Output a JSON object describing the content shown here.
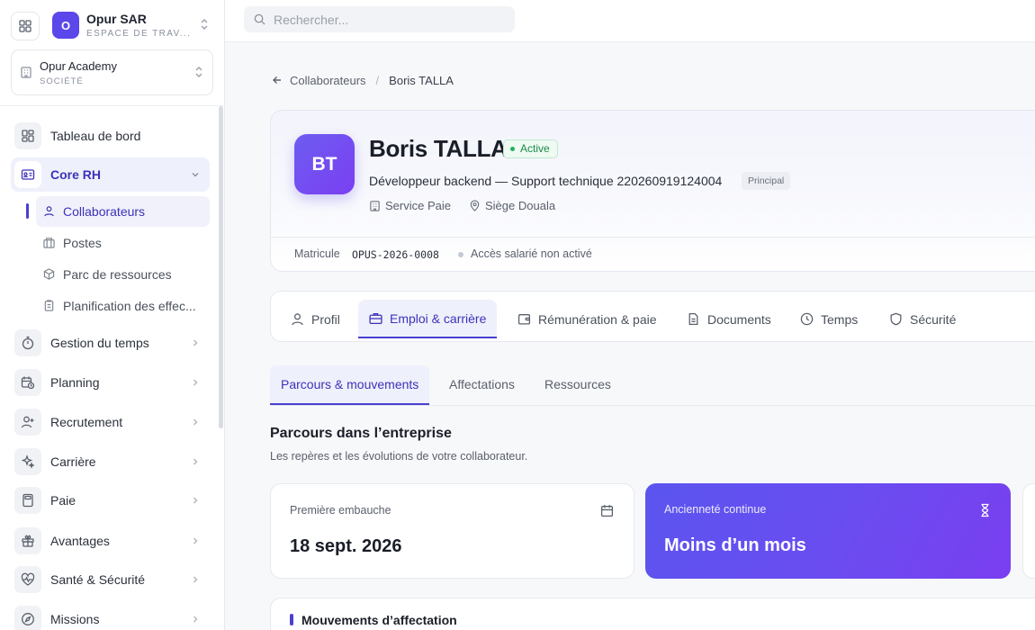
{
  "workspace": {
    "avatar": "O",
    "name": "Opur SAR",
    "subtitle": "ESPACE DE TRAV..."
  },
  "company": {
    "name": "Opur Academy",
    "subtitle": "SOCIÉTÉ"
  },
  "search": {
    "placeholder": "Rechercher..."
  },
  "nav": {
    "items": [
      {
        "label": "Tableau de bord",
        "icon": "dashboard-icon"
      },
      {
        "label": "Core RH",
        "icon": "id-card-icon",
        "active": true
      },
      {
        "label": "Gestion du temps",
        "icon": "stopwatch-icon"
      },
      {
        "label": "Planning",
        "icon": "calendar-clock-icon"
      },
      {
        "label": "Recrutement",
        "icon": "user-plus-icon"
      },
      {
        "label": "Carrière",
        "icon": "sparkles-icon"
      },
      {
        "label": "Paie",
        "icon": "calculator-icon"
      },
      {
        "label": "Avantages",
        "icon": "gift-icon"
      },
      {
        "label": "Santé & Sécurité",
        "icon": "heart-pulse-icon"
      },
      {
        "label": "Missions",
        "icon": "compass-icon"
      }
    ],
    "core_rh_children": [
      {
        "label": "Collaborateurs",
        "icon": "user-icon",
        "active": true
      },
      {
        "label": "Postes",
        "icon": "building-icon"
      },
      {
        "label": "Parc de ressources",
        "icon": "package-icon"
      },
      {
        "label": "Planification des effec...",
        "icon": "clipboard-icon"
      }
    ]
  },
  "breadcrumb": {
    "parent": "Collaborateurs",
    "separator": "/",
    "current": "Boris TALLA"
  },
  "profile": {
    "initials": "BT",
    "name": "Boris TALLA",
    "status": "Active",
    "role": "Développeur backend — Support technique 220260919124004",
    "badge": "Principal",
    "department": "Service Paie",
    "location": "Siège Douala",
    "matricule_label": "Matricule",
    "matricule_value": "OPUS-2026-0008",
    "access": "Accès salarié non activé"
  },
  "tabs": [
    {
      "label": "Profil",
      "icon": "user-icon"
    },
    {
      "label": "Emploi & carrière",
      "icon": "briefcase-icon",
      "active": true
    },
    {
      "label": "Rémunération & paie",
      "icon": "wallet-icon"
    },
    {
      "label": "Documents",
      "icon": "file-icon"
    },
    {
      "label": "Temps",
      "icon": "clock-icon"
    },
    {
      "label": "Sécurité",
      "icon": "shield-icon"
    }
  ],
  "subtabs": [
    {
      "label": "Parcours & mouvements",
      "active": true
    },
    {
      "label": "Affectations"
    },
    {
      "label": "Ressources"
    }
  ],
  "section": {
    "title": "Parcours dans l’entreprise",
    "subtitle": "Les repères et les évolutions de votre collaborateur."
  },
  "stats": [
    {
      "label": "Première embauche",
      "value": "18 sept. 2026",
      "icon": "calendar-icon"
    },
    {
      "label": "Ancienneté continue",
      "value": "Moins d’un mois",
      "icon": "hourglass-icon"
    }
  ],
  "movements": {
    "title": "Mouvements d’affectation"
  },
  "colors": {
    "accent": "#4a3fd0",
    "accent_bg": "#eef0fb",
    "status_green": "#1b8a4a"
  }
}
